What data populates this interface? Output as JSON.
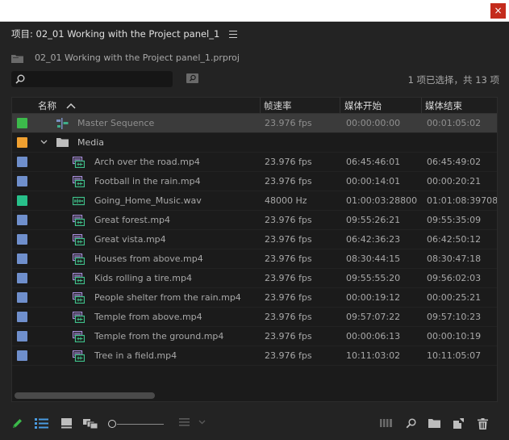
{
  "window": {
    "close_label": "×"
  },
  "panel": {
    "title": "项目: 02_01 Working with the Project panel_1",
    "project_file": "02_01 Working with the Project panel_1.prproj"
  },
  "search": {
    "value": "",
    "placeholder": ""
  },
  "selection_status": "1 项已选择，共 13 项",
  "columns": {
    "name": "名称",
    "frame_rate": "帧速率",
    "media_start": "媒体开始",
    "media_end": "媒体结束"
  },
  "colors": {
    "label_green": "#3cba4b",
    "label_orange": "#f0a030",
    "label_blue": "#6f8fcc",
    "label_teal": "#28c08a",
    "accent_green": "#3cba4b",
    "accent_blue": "#4a9be0"
  },
  "rows": [
    {
      "name": "Master Sequence",
      "frame_rate": "23.976 fps",
      "media_start": "00:00:00:00",
      "media_end": "00:01:05:02",
      "type": "sequence",
      "label_color": "#3cba4b",
      "indent": 1,
      "selected": true
    },
    {
      "name": "Media",
      "frame_rate": "",
      "media_start": "",
      "media_end": "",
      "type": "bin",
      "label_color": "#f0a030",
      "indent": 0,
      "expanded": true
    },
    {
      "name": "Arch over the road.mp4",
      "frame_rate": "23.976 fps",
      "media_start": "06:45:46:01",
      "media_end": "06:45:49:02",
      "type": "video",
      "label_color": "#6f8fcc",
      "indent": 2
    },
    {
      "name": "Football in the rain.mp4",
      "frame_rate": "23.976 fps",
      "media_start": "00:00:14:01",
      "media_end": "00:00:20:21",
      "type": "video",
      "label_color": "#6f8fcc",
      "indent": 2
    },
    {
      "name": "Going_Home_Music.wav",
      "frame_rate": "48000 Hz",
      "media_start": "01:00:03:28800",
      "media_end": "01:01:08:39708",
      "type": "audio",
      "label_color": "#28c08a",
      "indent": 2
    },
    {
      "name": "Great forest.mp4",
      "frame_rate": "23.976 fps",
      "media_start": "09:55:26:21",
      "media_end": "09:55:35:09",
      "type": "video",
      "label_color": "#6f8fcc",
      "indent": 2
    },
    {
      "name": "Great vista.mp4",
      "frame_rate": "23.976 fps",
      "media_start": "06:42:36:23",
      "media_end": "06:42:50:12",
      "type": "video",
      "label_color": "#6f8fcc",
      "indent": 2
    },
    {
      "name": "Houses from above.mp4",
      "frame_rate": "23.976 fps",
      "media_start": "08:30:44:15",
      "media_end": "08:30:47:18",
      "type": "video",
      "label_color": "#6f8fcc",
      "indent": 2
    },
    {
      "name": "Kids rolling a tire.mp4",
      "frame_rate": "23.976 fps",
      "media_start": "09:55:55:20",
      "media_end": "09:56:02:03",
      "type": "video",
      "label_color": "#6f8fcc",
      "indent": 2
    },
    {
      "name": "People shelter from the rain.mp4",
      "frame_rate": "23.976 fps",
      "media_start": "00:00:19:12",
      "media_end": "00:00:25:21",
      "type": "video",
      "label_color": "#6f8fcc",
      "indent": 2
    },
    {
      "name": "Temple from above.mp4",
      "frame_rate": "23.976 fps",
      "media_start": "09:57:07:22",
      "media_end": "09:57:10:23",
      "type": "video",
      "label_color": "#6f8fcc",
      "indent": 2
    },
    {
      "name": "Temple from the ground.mp4",
      "frame_rate": "23.976 fps",
      "media_start": "00:00:06:13",
      "media_end": "00:00:10:19",
      "type": "video",
      "label_color": "#6f8fcc",
      "indent": 2
    },
    {
      "name": "Tree in a field.mp4",
      "frame_rate": "23.976 fps",
      "media_start": "10:11:03:02",
      "media_end": "10:11:05:07",
      "type": "video",
      "label_color": "#6f8fcc",
      "indent": 2
    }
  ],
  "footer_icons": [
    "pencil-icon",
    "list-view-icon",
    "icon-view-icon",
    "freeform-view-icon",
    "zoom-slider",
    "sort-icon",
    "automate-to-sequence-icon",
    "find-icon",
    "new-bin-icon",
    "new-item-icon",
    "clear-icon"
  ]
}
